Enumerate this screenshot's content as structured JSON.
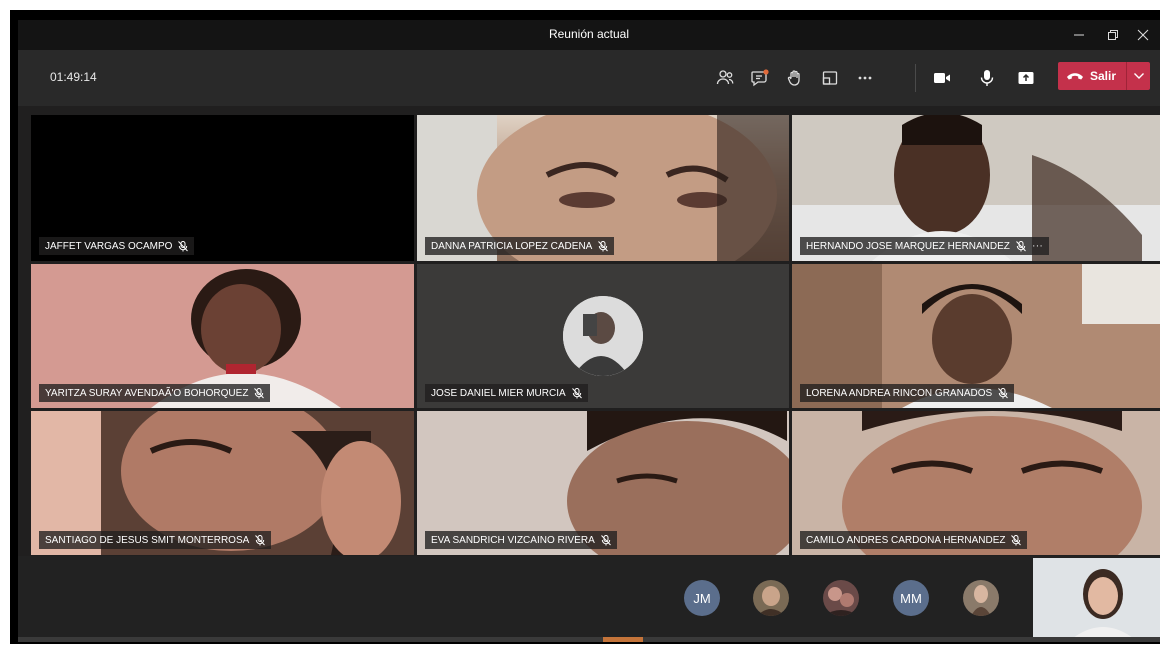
{
  "window": {
    "title": "Reunión actual",
    "controls": [
      "minimize-icon",
      "restore-icon",
      "close-icon"
    ]
  },
  "toolbar": {
    "timer": "01:49:14",
    "icons": [
      "participants-icon",
      "chat-icon",
      "raise-hand-icon",
      "rooms-icon",
      "more-icon",
      "camera-icon",
      "microphone-icon",
      "share-icon"
    ],
    "leave_label": "Salir",
    "leave_color": "#c4314b"
  },
  "participants": [
    {
      "name": "JAFFET VARGAS OCAMPO",
      "muted": true
    },
    {
      "name": "DANNA PATRICIA LOPEZ CADENA",
      "muted": true
    },
    {
      "name": "HERNANDO JOSE MARQUEZ HERNANDEZ",
      "muted": true,
      "more": "···"
    },
    {
      "name": "YARITZA SURAY AVENDAÃ'O BOHORQUEZ",
      "muted": true
    },
    {
      "name": "JOSE DANIEL MIER MURCIA",
      "muted": true
    },
    {
      "name": "LORENA ANDREA RINCON GRANADOS",
      "muted": true
    },
    {
      "name": "SANTIAGO DE JESUS SMIT MONTERROSA",
      "muted": true
    },
    {
      "name": "EVA SANDRICH VIZCAINO RIVERA",
      "muted": true
    },
    {
      "name": "CAMILO ANDRES CARDONA HERNANDEZ",
      "muted": true
    }
  ],
  "overflow_avatars": [
    {
      "initials": "JM",
      "color": "#5b6e8c"
    },
    {
      "initials": "",
      "color": "#7a6a55"
    },
    {
      "initials": "",
      "color": "#6a4a48"
    },
    {
      "initials": "MM",
      "color": "#5b6e8c"
    },
    {
      "initials": "",
      "color": "#8a7a6a"
    }
  ],
  "colors": {
    "window_bg": "#201f1f",
    "toolbar_bg": "#292929",
    "accent_notification": "#e06a3a"
  }
}
